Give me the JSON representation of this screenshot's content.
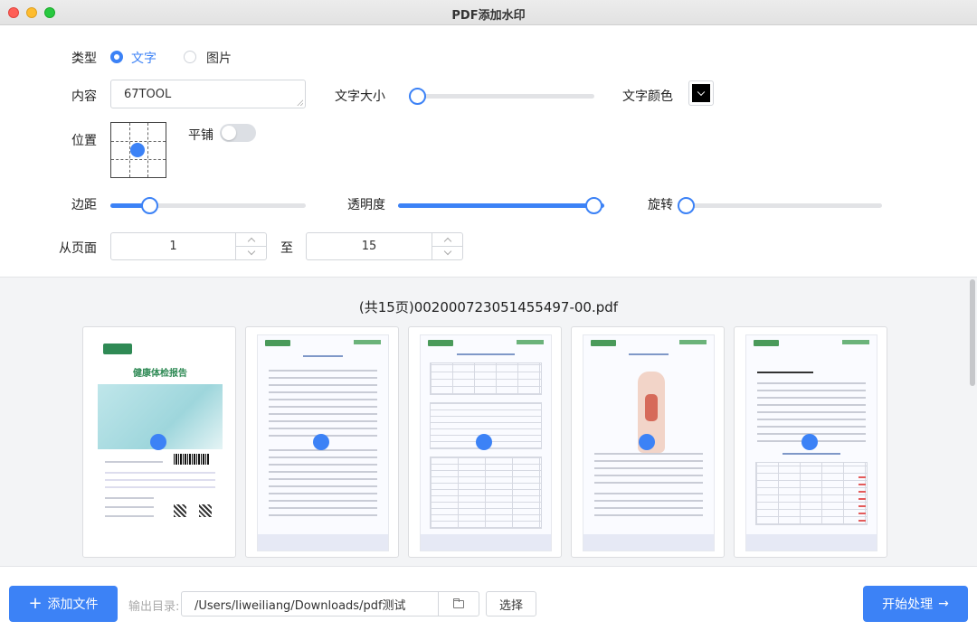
{
  "window": {
    "title": "PDF添加水印"
  },
  "settings": {
    "type_label": "类型",
    "type_options": [
      {
        "label": "文字",
        "selected": true
      },
      {
        "label": "图片",
        "selected": false
      }
    ],
    "content_label": "内容",
    "content_value": "67TOOL",
    "font_size_label": "文字大小",
    "font_size_value": 0.03,
    "font_color_label": "文字颜色",
    "font_color": "#000000",
    "position_label": "位置",
    "tile_label": "平铺",
    "tile_on": false,
    "margin_label": "边距",
    "margin_value": 0.2,
    "opacity_label": "透明度",
    "opacity_value": 1.0,
    "rotate_label": "旋转",
    "rotate_value": 0.0,
    "from_page_label": "从页面",
    "from_page": "1",
    "to_label": "至",
    "to_page": "15"
  },
  "preview": {
    "file_title": "(共15页)002000723051455497-00.pdf",
    "cover_title": "健康体检报告",
    "pages": [
      {
        "name": "cover"
      },
      {
        "name": "page-2"
      },
      {
        "name": "page-3"
      },
      {
        "name": "page-4"
      },
      {
        "name": "page-5"
      }
    ]
  },
  "bottom": {
    "add_file_label": "添加文件",
    "output_dir_label": "输出目录:",
    "output_dir_value": "/Users/liweiliang/Downloads/pdf测试",
    "choose_label": "选择",
    "start_label": "开始处理"
  },
  "colors": {
    "accent": "#3c82f6"
  }
}
